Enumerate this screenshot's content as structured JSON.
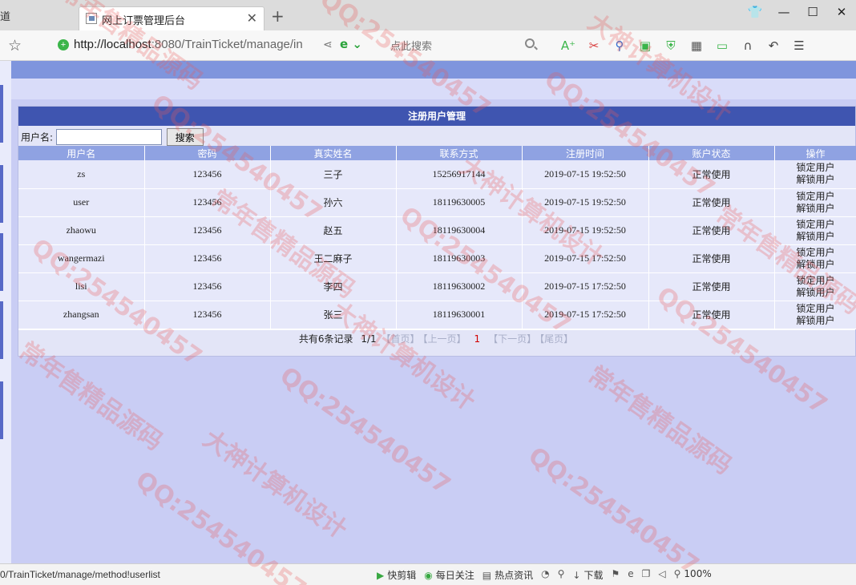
{
  "browser": {
    "prev_tab": "道",
    "tab_title": "网上订票管理后台",
    "new_tab": "+",
    "url_host": "http://localhost",
    "url_rest": ":8080/TrainTicket/manage/in",
    "search_placeholder": "点此搜索"
  },
  "panel": {
    "title": "注册用户管理",
    "username_label": "用户名:",
    "username_value": "",
    "search_button": "搜索"
  },
  "table": {
    "headers": [
      "用户名",
      "密码",
      "真实姓名",
      "联系方式",
      "注册时间",
      "账户状态",
      "操作"
    ],
    "rows": [
      {
        "username": "zs",
        "password": "123456",
        "realname": "三子",
        "phone": "15256917144",
        "time": "2019-07-15 19:52:50",
        "status": "正常使用"
      },
      {
        "username": "user",
        "password": "123456",
        "realname": "孙六",
        "phone": "18119630005",
        "time": "2019-07-15 19:52:50",
        "status": "正常使用"
      },
      {
        "username": "zhaowu",
        "password": "123456",
        "realname": "赵五",
        "phone": "18119630004",
        "time": "2019-07-15 19:52:50",
        "status": "正常使用"
      },
      {
        "username": "wangermazi",
        "password": "123456",
        "realname": "王二麻子",
        "phone": "18119630003",
        "time": "2019-07-15 17:52:50",
        "status": "正常使用"
      },
      {
        "username": "lisi",
        "password": "123456",
        "realname": "李四",
        "phone": "18119630002",
        "time": "2019-07-15 17:52:50",
        "status": "正常使用"
      },
      {
        "username": "zhangsan",
        "password": "123456",
        "realname": "张三",
        "phone": "18119630001",
        "time": "2019-07-15 17:52:50",
        "status": "正常使用"
      }
    ],
    "lock_label": "锁定用户",
    "unlock_label": "解锁用户"
  },
  "pager": {
    "summary": "共有6条记录",
    "page": "1/1",
    "first": "【首页】",
    "prev": "【上一页】",
    "current": "1",
    "next": "【下一页】",
    "last": "【尾页】"
  },
  "statusbar": {
    "path": "0/TrainTicket/manage/method!userlist",
    "items": [
      "快剪辑",
      "每日关注",
      "热点资讯",
      "下载",
      "100%"
    ]
  },
  "watermark": {
    "qq": "QQ:254540457",
    "a": "大神计算机设计",
    "b": "常年售精品源码"
  },
  "colors": {
    "header": "#3f55b0",
    "th": "#8fa2e2",
    "page_bg": "#c9cdf4"
  }
}
